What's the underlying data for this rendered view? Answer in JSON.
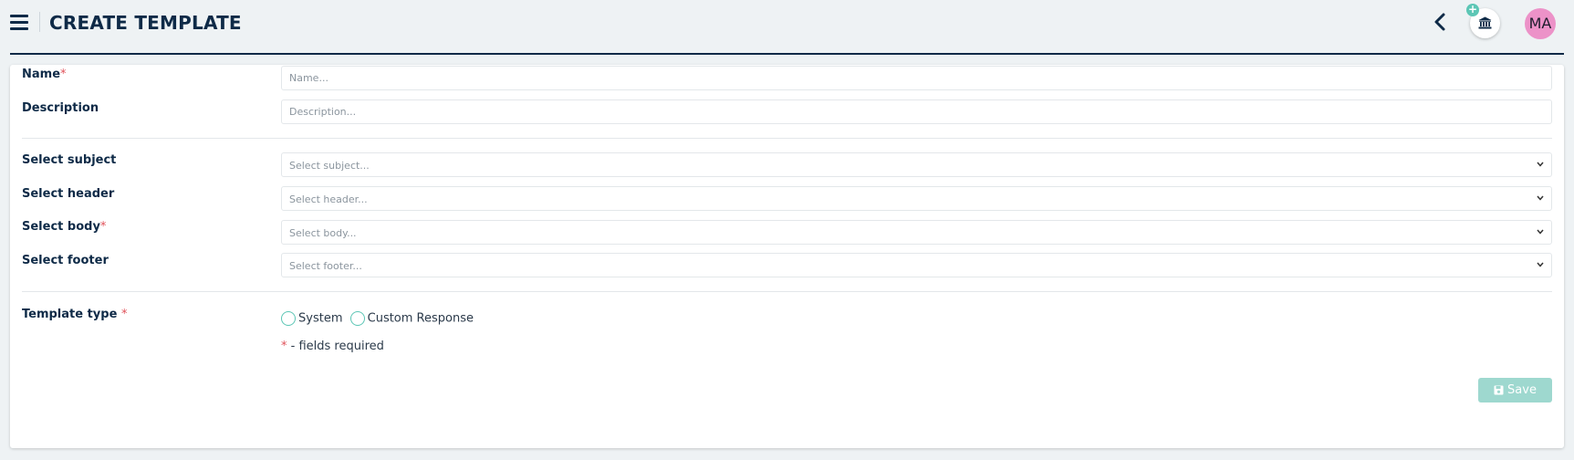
{
  "header": {
    "title": "CREATE TEMPLATE",
    "avatar_initials": "MA",
    "plus_badge": "+"
  },
  "form": {
    "name": {
      "label": "Name",
      "required_mark": "*",
      "placeholder": "Name..."
    },
    "description": {
      "label": "Description",
      "placeholder": "Description..."
    },
    "subject": {
      "label": "Select subject",
      "placeholder": "Select subject..."
    },
    "header_select": {
      "label": "Select header",
      "placeholder": "Select header..."
    },
    "body": {
      "label": "Select body",
      "required_mark": "*",
      "placeholder": "Select body..."
    },
    "footer": {
      "label": "Select footer",
      "placeholder": "Select footer..."
    },
    "template_type": {
      "label": "Template type",
      "required_mark": "*",
      "options": [
        "System",
        "Custom Response"
      ]
    },
    "required_note": {
      "mark": "*",
      "text": " - fields required"
    },
    "save_label": "Save"
  },
  "icons": {
    "menu": "hamburger-menu-icon",
    "back": "chevron-left-icon",
    "bank": "bank-icon",
    "select_arrow": "chevron-down-icon",
    "save": "floppy-disk-icon"
  },
  "colors": {
    "primary_dark": "#0e2a47",
    "accent_teal": "#5cc6b5",
    "save_disabled": "#9ed8cf",
    "avatar_bg": "#ec92c8",
    "required_red": "#e0525a"
  }
}
